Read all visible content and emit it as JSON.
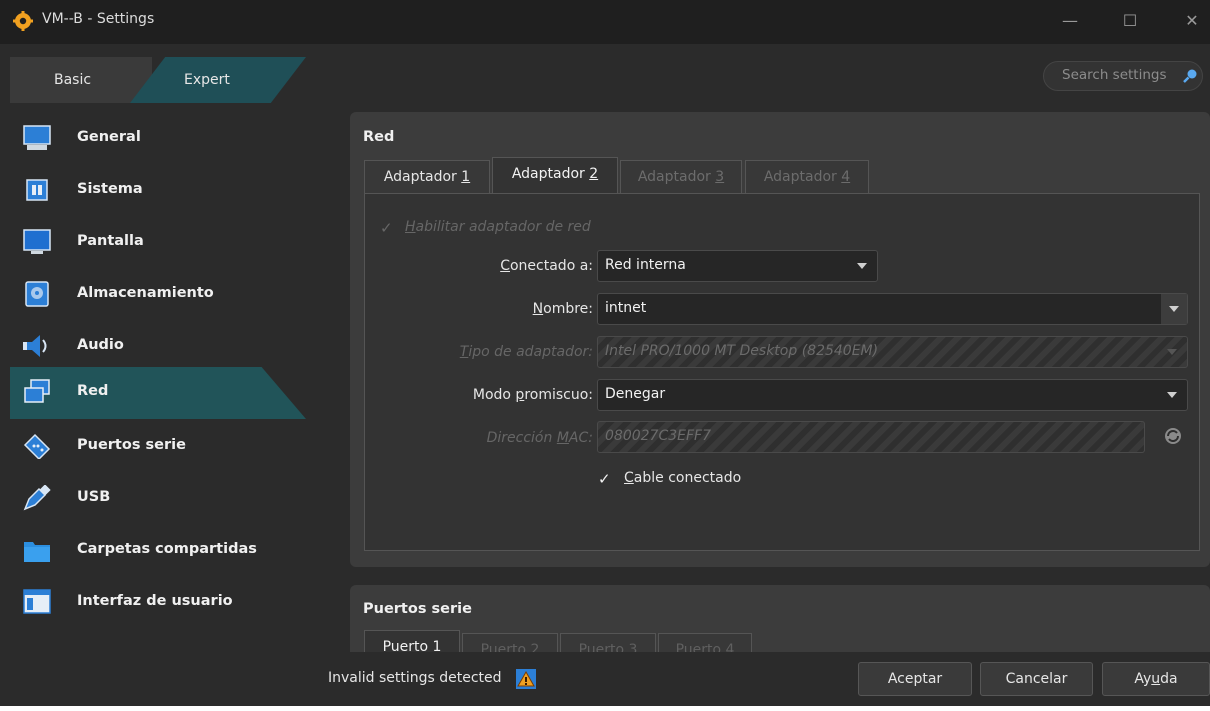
{
  "window": {
    "title": "VM--B - Settings",
    "minimize": "—",
    "maximize": "☐",
    "close": "✕"
  },
  "mode": {
    "basic": "Basic",
    "expert": "Expert"
  },
  "search": {
    "placeholder": "Search settings"
  },
  "sidebar": {
    "items": [
      {
        "label": "General",
        "icon": "general-icon"
      },
      {
        "label": "Sistema",
        "icon": "system-icon"
      },
      {
        "label": "Pantalla",
        "icon": "display-icon"
      },
      {
        "label": "Almacenamiento",
        "icon": "storage-icon"
      },
      {
        "label": "Audio",
        "icon": "audio-icon"
      },
      {
        "label": "Red",
        "icon": "network-icon",
        "active": true
      },
      {
        "label": "Puertos serie",
        "icon": "serial-ports-icon"
      },
      {
        "label": "USB",
        "icon": "usb-icon"
      },
      {
        "label": "Carpetas compartidas",
        "icon": "shared-folders-icon"
      },
      {
        "label": "Interfaz de usuario",
        "icon": "user-interface-icon"
      }
    ]
  },
  "network": {
    "title": "Red",
    "tabs": [
      {
        "pre": "Adaptador ",
        "key": "1",
        "state": "normal"
      },
      {
        "pre": "Adaptador ",
        "key": "2",
        "state": "active"
      },
      {
        "pre": "Adaptador ",
        "key": "3",
        "state": "disabled"
      },
      {
        "pre": "Adaptador ",
        "key": "4",
        "state": "disabled"
      }
    ],
    "enable_adapter": {
      "key": "H",
      "rest": "abilitar adaptador de red",
      "checked": true
    },
    "attached_to": {
      "label_key": "C",
      "label_rest": "onectado a:",
      "value": "Red interna"
    },
    "name": {
      "label_key": "N",
      "label_rest": "ombre:",
      "value": "intnet"
    },
    "adapter_type": {
      "label_key": "T",
      "label_rest": "ipo de adaptador:",
      "value": "Intel PRO/1000 MT Desktop (82540EM)"
    },
    "promiscuous": {
      "label_pre": "Modo ",
      "label_key": "p",
      "label_rest": "romiscuo:",
      "value": "Denegar"
    },
    "mac": {
      "label_pre": "Dirección ",
      "label_key": "M",
      "label_rest": "AC:",
      "value": "080027C3EFF7"
    },
    "cable": {
      "key": "C",
      "rest": "able conectado",
      "checked": true
    }
  },
  "serial": {
    "title": "Puertos serie",
    "tabs": [
      "Puerto 1",
      "Puerto 2",
      "Puerto 3",
      "Puerto 4"
    ]
  },
  "footer": {
    "status": "Invalid settings detected",
    "ok": "Aceptar",
    "cancel": "Cancelar",
    "help_pre": "Ay",
    "help_key": "u",
    "help_rest": "da"
  }
}
